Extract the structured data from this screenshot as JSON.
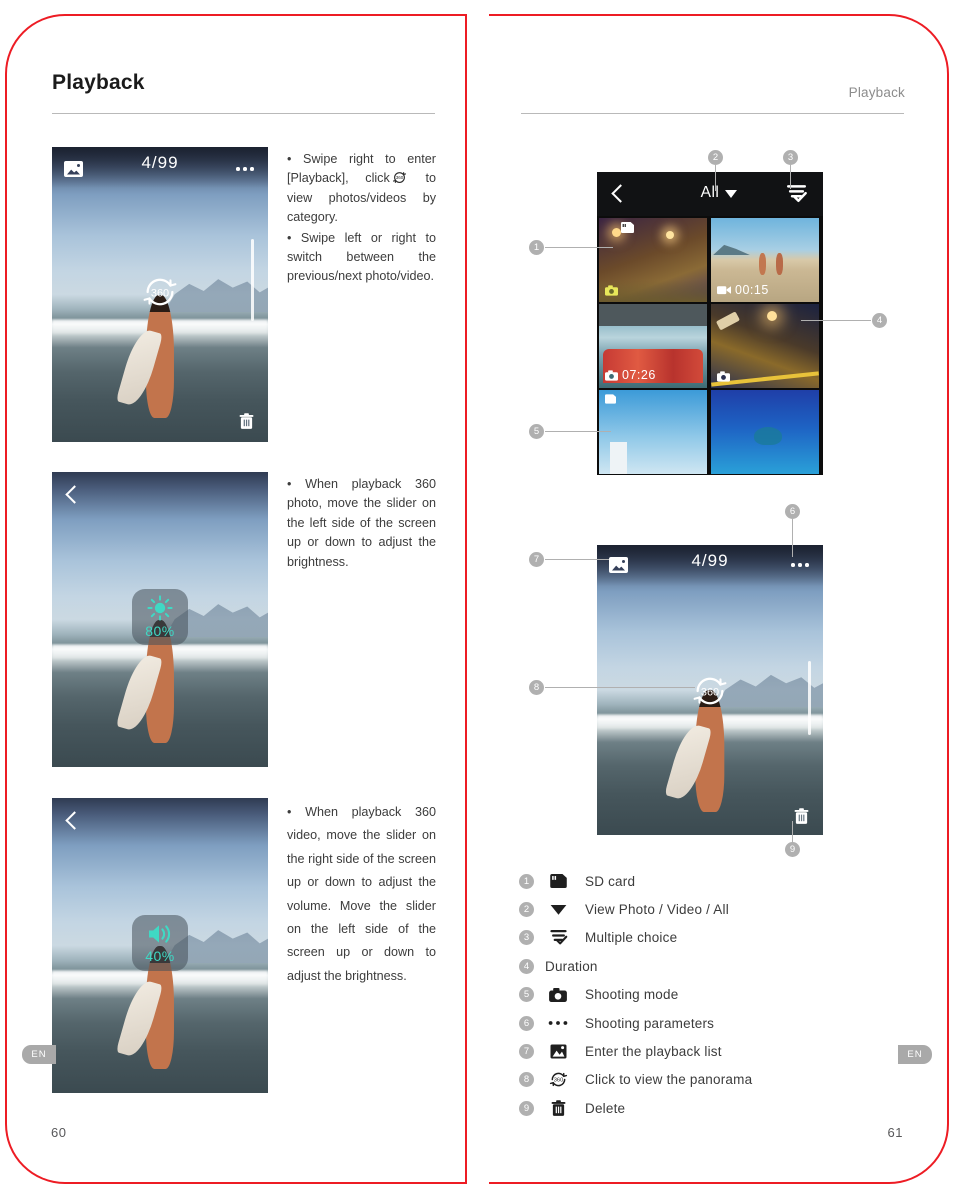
{
  "document": {
    "brand_border_color": "#ed1c24",
    "accent_hud_color": "#3fd9c4"
  },
  "left_page": {
    "title": "Playback",
    "page_number": "60",
    "lang_tab": "EN",
    "blocks": [
      {
        "line1": "• Swipe right to enter [Playback], click",
        "line2": "to view photos/videos by category.",
        "bullet2": "• Swipe left or right to switch between the previous/next photo/video."
      }
    ],
    "text_block_2": "• When playback 360 photo, move the slider on the left side of the screen up or down to adjust the brightness.",
    "text_block_3": "• When playback 360 video, move the slider on the right side of the screen up or down to adjust the volume. Move the slider on the left side of the screen up or down to adjust the brightness.",
    "mock1": {
      "counter": "4/99",
      "badge": "360",
      "gallery_icon": "image-icon",
      "menu_icon": "more-dots-icon",
      "delete_icon": "trash-icon"
    },
    "mock2": {
      "back_icon": "back-chevron-icon",
      "hud_icon": "brightness-sun-icon",
      "hud_value": "80%"
    },
    "mock3": {
      "back_icon": "back-chevron-icon",
      "hud_icon": "volume-speaker-icon",
      "hud_value": "40%"
    }
  },
  "right_page": {
    "header": "Playback",
    "page_number": "61",
    "lang_tab": "EN",
    "gallery": {
      "back_icon": "back-chevron-icon",
      "filter_label": "All",
      "filter_caret": "caret-down-icon",
      "multi_select_icon": "multiple-choice-icon",
      "cells": [
        {
          "chip_icon": "sd-card-icon",
          "chip_text": ""
        },
        {
          "chip_icon": "video-icon",
          "chip_text": "00:15"
        },
        {
          "chip_icon": "camera-icon",
          "chip_text": "07:26"
        },
        {
          "chip_icon": "camera-icon",
          "chip_text": ""
        },
        {
          "chip_icon": "sd-card-icon",
          "chip_text": ""
        },
        {
          "chip_icon": "",
          "chip_text": ""
        }
      ]
    },
    "viewer": {
      "counter": "4/99",
      "badge": "360",
      "gallery_icon": "image-icon",
      "menu_icon": "more-dots-icon",
      "delete_icon": "trash-icon"
    },
    "callouts": [
      "1",
      "2",
      "3",
      "4",
      "5",
      "6",
      "7",
      "8",
      "9"
    ],
    "legend": [
      {
        "num": "1",
        "icon": "sd-card-icon",
        "label": "SD card"
      },
      {
        "num": "2",
        "icon": "caret-down-icon",
        "label": "View Photo / Video / All"
      },
      {
        "num": "3",
        "icon": "multiple-choice-icon",
        "label": "Multiple choice"
      },
      {
        "num": "4",
        "icon": "",
        "label": "Duration"
      },
      {
        "num": "5",
        "icon": "camera-icon",
        "label": "Shooting mode"
      },
      {
        "num": "6",
        "icon": "more-dots-icon",
        "label": "Shooting parameters"
      },
      {
        "num": "7",
        "icon": "image-icon",
        "label": "Enter the playback list"
      },
      {
        "num": "8",
        "icon": "panorama-360-icon",
        "label": "Click to view the panorama"
      },
      {
        "num": "9",
        "icon": "trash-icon",
        "label": "Delete"
      }
    ]
  }
}
